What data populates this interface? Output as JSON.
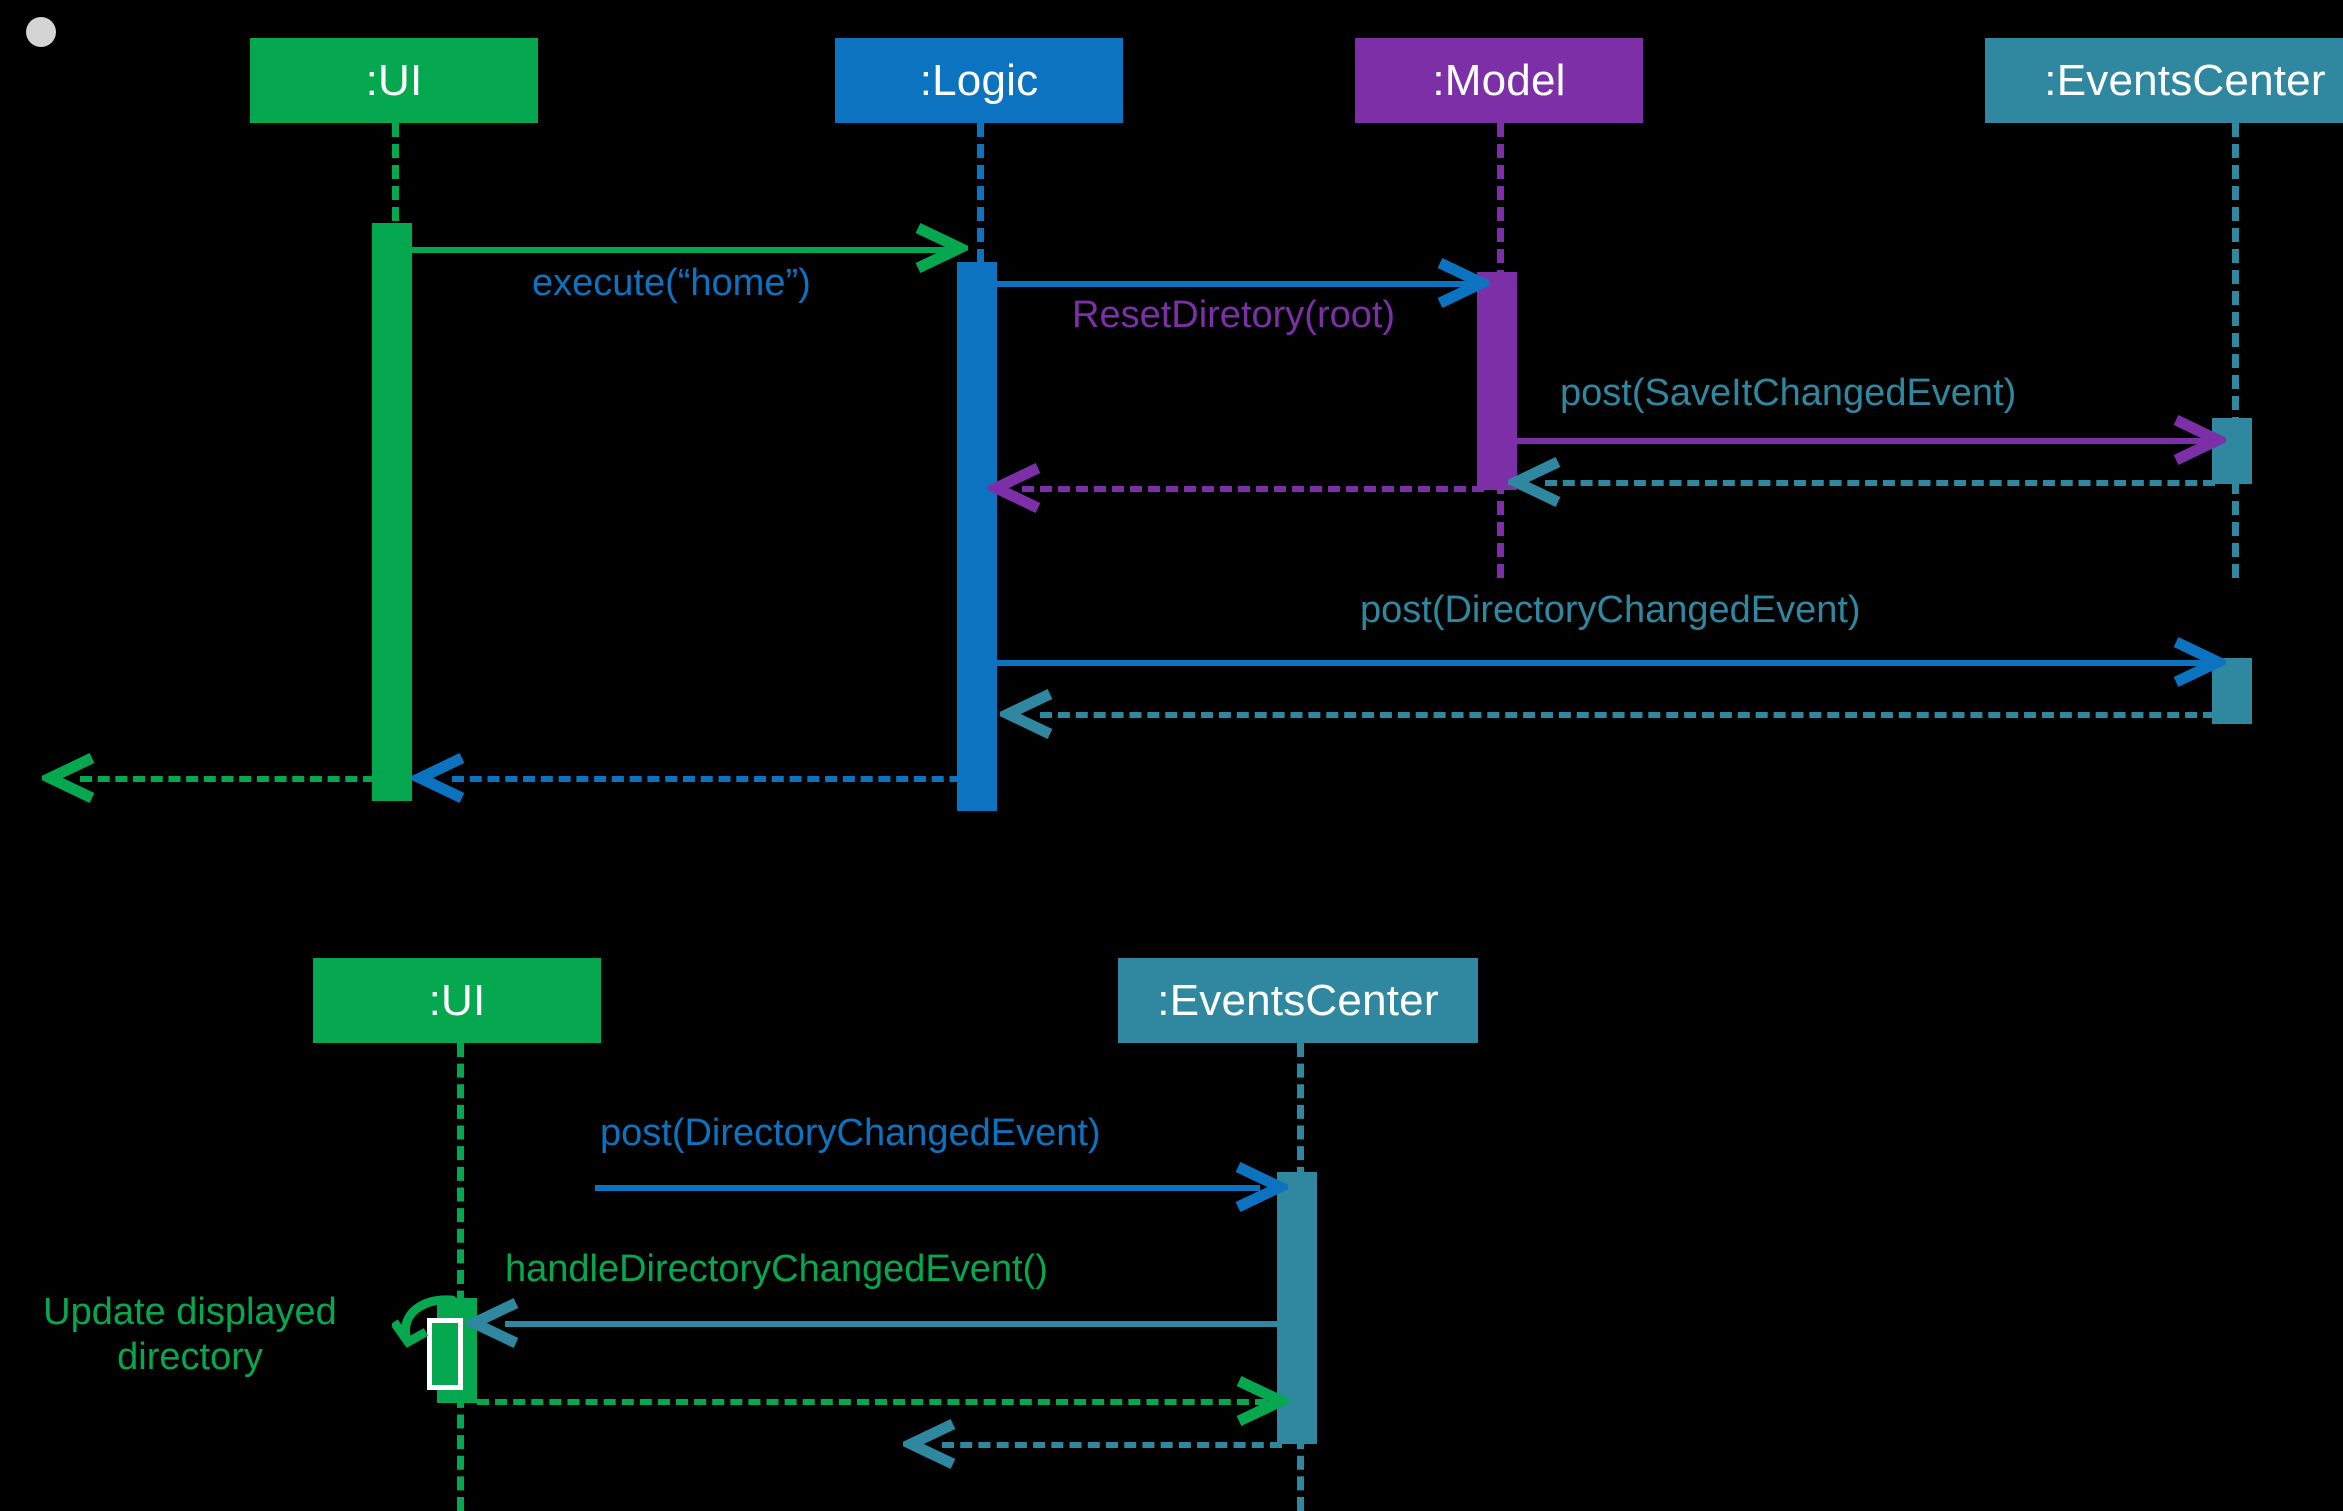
{
  "diagram": {
    "type": "uml-sequence-diagram",
    "title": "",
    "background_color": "#000000"
  },
  "colors": {
    "ui": "#06a84f",
    "logic": "#0c73c1",
    "model": "#7d2fa8",
    "eventscenter": "#2f87a0",
    "white": "#ffffff",
    "marker_dot": "#d4d4d4"
  },
  "frames": [
    {
      "id": "frame-top",
      "participants": [
        {
          "id": "ui",
          "label": ":UI",
          "color": "#06a84f"
        },
        {
          "id": "logic",
          "label": ":Logic",
          "color": "#0c73c1"
        },
        {
          "id": "model",
          "label": ":Model",
          "color": "#7d2fa8"
        },
        {
          "id": "eventscenter",
          "label": ":EventsCenter",
          "color": "#2f87a0"
        }
      ],
      "messages": [
        {
          "id": "m1",
          "label": "execute(“home”)",
          "from": "ui",
          "to": "logic",
          "kind": "call",
          "line_color": "#06a84f",
          "label_color": "#0c73c1"
        },
        {
          "id": "m2",
          "label": "ResetDiretory(root)",
          "from": "logic",
          "to": "model",
          "kind": "call",
          "line_color": "#0c73c1",
          "label_color": "#7d2fa8"
        },
        {
          "id": "m3",
          "label": "post(SaveItChangedEvent)",
          "from": "model",
          "to": "eventscenter",
          "kind": "call",
          "line_color": "#7d2fa8",
          "label_color": "#2f87a0"
        },
        {
          "id": "m4",
          "label": "",
          "from": "eventscenter",
          "to": "model",
          "kind": "return",
          "line_color": "#2f87a0",
          "label_color": "#2f87a0"
        },
        {
          "id": "m5",
          "label": "",
          "from": "model",
          "to": "logic",
          "kind": "return",
          "line_color": "#7d2fa8",
          "label_color": "#7d2fa8"
        },
        {
          "id": "m6",
          "label": "post(DirectoryChangedEvent)",
          "from": "logic",
          "to": "eventscenter",
          "kind": "call",
          "line_color": "#0c73c1",
          "label_color": "#2f87a0"
        },
        {
          "id": "m7",
          "label": "",
          "from": "eventscenter",
          "to": "logic",
          "kind": "return",
          "line_color": "#2f87a0",
          "label_color": "#2f87a0"
        },
        {
          "id": "m8",
          "label": "",
          "from": "logic",
          "to": "ui",
          "kind": "return",
          "line_color": "#0c73c1",
          "label_color": "#0c73c1"
        },
        {
          "id": "m9",
          "label": "",
          "from": "ui",
          "to": "actor",
          "kind": "return",
          "line_color": "#06a84f",
          "label_color": "#06a84f"
        }
      ]
    },
    {
      "id": "frame-bottom",
      "participants": [
        {
          "id": "ui2",
          "label": ":UI",
          "color": "#06a84f"
        },
        {
          "id": "eventscenter2",
          "label": ":EventsCenter",
          "color": "#2f87a0"
        }
      ],
      "messages": [
        {
          "id": "n1",
          "label": "post(DirectoryChangedEvent)",
          "from": "external",
          "to": "eventscenter2",
          "kind": "call",
          "line_color": "#0c73c1",
          "label_color": "#0c73c1"
        },
        {
          "id": "n2",
          "label": "handleDirectoryChangedEvent()",
          "from": "eventscenter2",
          "to": "ui2",
          "kind": "call",
          "line_color": "#2f87a0",
          "label_color": "#06a84f"
        },
        {
          "id": "n3",
          "label": "",
          "from": "ui2",
          "to": "eventscenter2",
          "kind": "return",
          "line_color": "#06a84f",
          "label_color": "#06a84f"
        },
        {
          "id": "n4",
          "label": "",
          "from": "eventscenter2",
          "to": "external",
          "kind": "return",
          "line_color": "#2f87a0",
          "label_color": "#2f87a0"
        }
      ],
      "notes": [
        {
          "id": "note1",
          "label_line1": "Update displayed",
          "label_line2": "directory",
          "color": "#06a84f"
        }
      ]
    }
  ]
}
